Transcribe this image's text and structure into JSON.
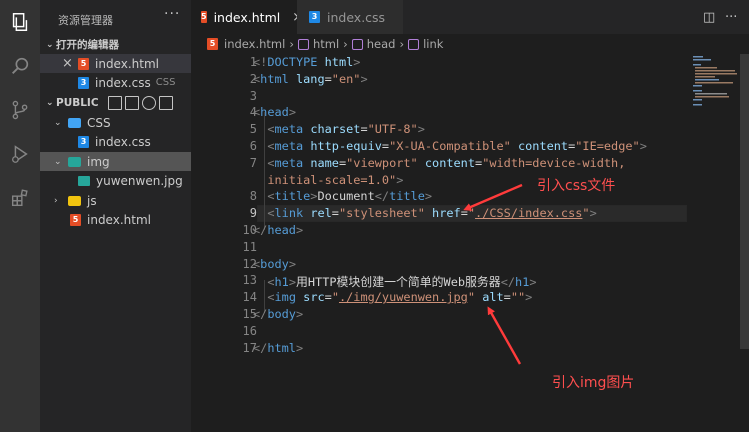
{
  "activity_bar": {
    "items": [
      {
        "name": "explorer-icon"
      },
      {
        "name": "search-icon"
      },
      {
        "name": "source-control-icon"
      },
      {
        "name": "run-debug-icon"
      },
      {
        "name": "extensions-icon"
      }
    ]
  },
  "sidebar": {
    "title": "资源管理器",
    "more": "···",
    "open_editors": {
      "header": "打开的编辑器",
      "items": [
        {
          "close": "×",
          "icon": "5",
          "label": "index.html",
          "hint": ""
        },
        {
          "close": "",
          "icon": "3",
          "label": "index.css",
          "hint": "CSS"
        }
      ]
    },
    "workspace": {
      "header": "PUBLIC",
      "tree": [
        {
          "label": "CSS",
          "chevron": "⌄"
        },
        {
          "label": "index.css",
          "icon": "3"
        },
        {
          "label": "img",
          "chevron": "⌄"
        },
        {
          "label": "yuwenwen.jpg"
        },
        {
          "label": "js",
          "chevron": "›"
        },
        {
          "label": "index.html",
          "icon": "5"
        }
      ]
    }
  },
  "tabs": [
    {
      "icon": "5",
      "label": "index.html",
      "close": "×",
      "active": true
    },
    {
      "icon": "3",
      "label": "index.css",
      "close": "",
      "active": false
    }
  ],
  "editor_actions": {
    "split": "◫",
    "more": "···"
  },
  "breadcrumb": {
    "file_icon": "5",
    "items": [
      "index.html",
      "html",
      "head",
      "link"
    ],
    "separator": "›"
  },
  "editor": {
    "current_line": 9,
    "line_numbers": [
      "1",
      "2",
      "3",
      "4",
      "5",
      "6",
      "7",
      "8",
      "9",
      "10",
      "11",
      "12",
      "13",
      "14",
      "15",
      "16",
      "17"
    ],
    "lines": [
      [
        {
          "c": "p",
          "t": "<!"
        },
        {
          "c": "t",
          "t": "DOCTYPE"
        },
        {
          "c": "x",
          "t": " "
        },
        {
          "c": "a",
          "t": "html"
        },
        {
          "c": "p",
          "t": ">"
        }
      ],
      [
        {
          "c": "p",
          "t": "<"
        },
        {
          "c": "t",
          "t": "html"
        },
        {
          "c": "x",
          "t": " "
        },
        {
          "c": "a",
          "t": "lang"
        },
        {
          "c": "x",
          "t": "="
        },
        {
          "c": "s",
          "t": "\"en\""
        },
        {
          "c": "p",
          "t": ">"
        }
      ],
      [],
      [
        {
          "c": "p",
          "t": "<"
        },
        {
          "c": "t",
          "t": "head"
        },
        {
          "c": "p",
          "t": ">"
        }
      ],
      [
        {
          "c": "x",
          "t": "  "
        },
        {
          "c": "p",
          "t": "<"
        },
        {
          "c": "t",
          "t": "meta"
        },
        {
          "c": "x",
          "t": " "
        },
        {
          "c": "a",
          "t": "charset"
        },
        {
          "c": "x",
          "t": "="
        },
        {
          "c": "s",
          "t": "\"UTF-8\""
        },
        {
          "c": "p",
          "t": ">"
        }
      ],
      [
        {
          "c": "x",
          "t": "  "
        },
        {
          "c": "p",
          "t": "<"
        },
        {
          "c": "t",
          "t": "meta"
        },
        {
          "c": "x",
          "t": " "
        },
        {
          "c": "a",
          "t": "http-equiv"
        },
        {
          "c": "x",
          "t": "="
        },
        {
          "c": "s",
          "t": "\"X-UA-Compatible\""
        },
        {
          "c": "x",
          "t": " "
        },
        {
          "c": "a",
          "t": "content"
        },
        {
          "c": "x",
          "t": "="
        },
        {
          "c": "s",
          "t": "\"IE=edge\""
        },
        {
          "c": "p",
          "t": ">"
        }
      ],
      [
        {
          "c": "x",
          "t": "  "
        },
        {
          "c": "p",
          "t": "<"
        },
        {
          "c": "t",
          "t": "meta"
        },
        {
          "c": "x",
          "t": " "
        },
        {
          "c": "a",
          "t": "name"
        },
        {
          "c": "x",
          "t": "="
        },
        {
          "c": "s",
          "t": "\"viewport\""
        },
        {
          "c": "x",
          "t": " "
        },
        {
          "c": "a",
          "t": "content"
        },
        {
          "c": "x",
          "t": "="
        },
        {
          "c": "s",
          "t": "\"width=device-width,"
        }
      ],
      [
        {
          "c": "s",
          "t": "  initial-scale=1.0\""
        },
        {
          "c": "p",
          "t": ">"
        }
      ],
      [
        {
          "c": "x",
          "t": "  "
        },
        {
          "c": "p",
          "t": "<"
        },
        {
          "c": "t",
          "t": "title"
        },
        {
          "c": "p",
          "t": ">"
        },
        {
          "c": "x",
          "t": "Document"
        },
        {
          "c": "p",
          "t": "</"
        },
        {
          "c": "t",
          "t": "title"
        },
        {
          "c": "p",
          "t": ">"
        }
      ],
      [
        {
          "c": "x",
          "t": "  "
        },
        {
          "c": "p",
          "t": "<"
        },
        {
          "c": "t",
          "t": "link"
        },
        {
          "c": "x",
          "t": " "
        },
        {
          "c": "a",
          "t": "rel"
        },
        {
          "c": "x",
          "t": "="
        },
        {
          "c": "s",
          "t": "\"stylesheet\""
        },
        {
          "c": "x",
          "t": " "
        },
        {
          "c": "a",
          "t": "href"
        },
        {
          "c": "x",
          "t": "="
        },
        {
          "c": "s",
          "t": "\""
        },
        {
          "c": "su",
          "t": "./CSS/index.css"
        },
        {
          "c": "s",
          "t": "\""
        },
        {
          "c": "p",
          "t": ">"
        }
      ],
      [
        {
          "c": "p",
          "t": "</"
        },
        {
          "c": "t",
          "t": "head"
        },
        {
          "c": "p",
          "t": ">"
        }
      ],
      [],
      [
        {
          "c": "p",
          "t": "<"
        },
        {
          "c": "t",
          "t": "body"
        },
        {
          "c": "p",
          "t": ">"
        }
      ],
      [
        {
          "c": "x",
          "t": "  "
        },
        {
          "c": "p",
          "t": "<"
        },
        {
          "c": "t",
          "t": "h1"
        },
        {
          "c": "p",
          "t": ">"
        },
        {
          "c": "x",
          "t": "用HTTP模块创建一个简单的Web服务器"
        },
        {
          "c": "p",
          "t": "</"
        },
        {
          "c": "t",
          "t": "h1"
        },
        {
          "c": "p",
          "t": ">"
        }
      ],
      [
        {
          "c": "x",
          "t": "  "
        },
        {
          "c": "p",
          "t": "<"
        },
        {
          "c": "t",
          "t": "img"
        },
        {
          "c": "x",
          "t": " "
        },
        {
          "c": "a",
          "t": "src"
        },
        {
          "c": "x",
          "t": "="
        },
        {
          "c": "s",
          "t": "\""
        },
        {
          "c": "su",
          "t": "./img/yuwenwen.jpg"
        },
        {
          "c": "s",
          "t": "\""
        },
        {
          "c": "x",
          "t": " "
        },
        {
          "c": "a",
          "t": "alt"
        },
        {
          "c": "x",
          "t": "="
        },
        {
          "c": "s",
          "t": "\"\""
        },
        {
          "c": "p",
          "t": ">"
        }
      ],
      [
        {
          "c": "p",
          "t": "</"
        },
        {
          "c": "t",
          "t": "body"
        },
        {
          "c": "p",
          "t": ">"
        }
      ],
      [],
      [
        {
          "c": "p",
          "t": "</"
        },
        {
          "c": "t",
          "t": "html"
        },
        {
          "c": "p",
          "t": ">"
        }
      ]
    ]
  },
  "annotations": {
    "css_note": "引入css文件",
    "img_note": "引入img图片",
    "color": "#ff3b3b"
  },
  "colors": {
    "activity_bar": "#333333",
    "sidebar": "#252526",
    "editor": "#1e1e1e",
    "selected_row": "#555555",
    "html_icon": "#e44d26",
    "css_icon": "#1e88e5"
  }
}
